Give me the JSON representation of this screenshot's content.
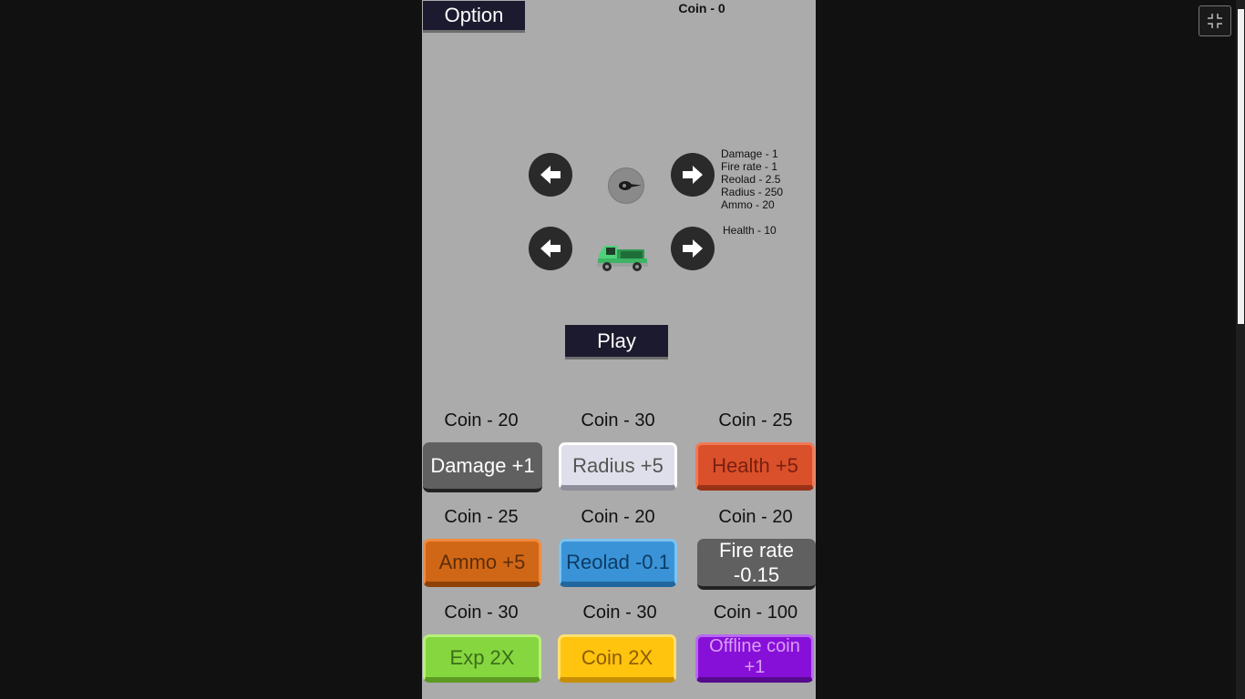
{
  "header": {
    "option_label": "Option",
    "coin_label": "Coin - 0"
  },
  "turret_stats": [
    "Damage - 1",
    "Fire rate - 1",
    "Reolad - 2.5",
    "Radius - 250",
    "Ammo - 20"
  ],
  "vehicle_stats": [
    "Health - 10"
  ],
  "play_label": "Play",
  "upgrades": [
    {
      "price": "Coin - 20",
      "label": "Damage +1"
    },
    {
      "price": "Coin - 30",
      "label": "Radius +5"
    },
    {
      "price": "Coin - 25",
      "label": "Health +5"
    },
    {
      "price": "Coin - 25",
      "label": "Ammo +5"
    },
    {
      "price": "Coin - 20",
      "label": "Reolad -0.1"
    },
    {
      "price": "Coin - 20",
      "label": "Fire rate -0.15"
    },
    {
      "price": "Coin - 30",
      "label": "Exp 2X"
    },
    {
      "price": "Coin - 30",
      "label": "Coin 2X"
    },
    {
      "price": "Coin - 100",
      "label": "Offline coin +1"
    }
  ],
  "icons": {
    "prev_arrow": "arrow-left-icon",
    "next_arrow": "arrow-right-icon",
    "turret": "turret-icon",
    "vehicle": "truck-icon",
    "fullscreen": "exit-fullscreen-icon"
  },
  "colors": {
    "background": "#111111",
    "game_panel": "#ababab",
    "dark_button": "#1c1a2e",
    "damage": "#606060",
    "radius": "#dedfea",
    "health": "#d9502a",
    "ammo": "#d06716",
    "reload": "#3a93d6",
    "fire_rate": "#606060",
    "exp": "#86d640",
    "coin": "#ffc40d",
    "offline": "#8710d8"
  }
}
